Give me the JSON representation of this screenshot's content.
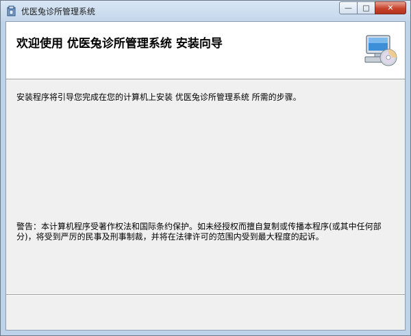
{
  "window": {
    "title": "优医兔诊所管理系统",
    "controls": {
      "minimize_glyph": "—",
      "maximize_glyph": "□",
      "close_glyph": "✕"
    }
  },
  "header": {
    "title": "欢迎使用  优医兔诊所管理系统  安装向导",
    "icon": "computer-disc-icon"
  },
  "content": {
    "intro": "安装程序将引导您完成在您的计算机上安装  优医兔诊所管理系统  所需的步骤。",
    "warning": "警告：本计算机程序受著作权法和国际条约保护。如未经授权而擅自复制或传播本程序(或其中任何部分)，将受到严厉的民事及刑事制裁，并将在法律许可的范围内受到最大程度的起诉。"
  },
  "colors": {
    "titlebar": "#c9dbef",
    "client_bg": "#f0f0f0",
    "header_bg": "#ffffff",
    "close_button": "#c7432b"
  }
}
